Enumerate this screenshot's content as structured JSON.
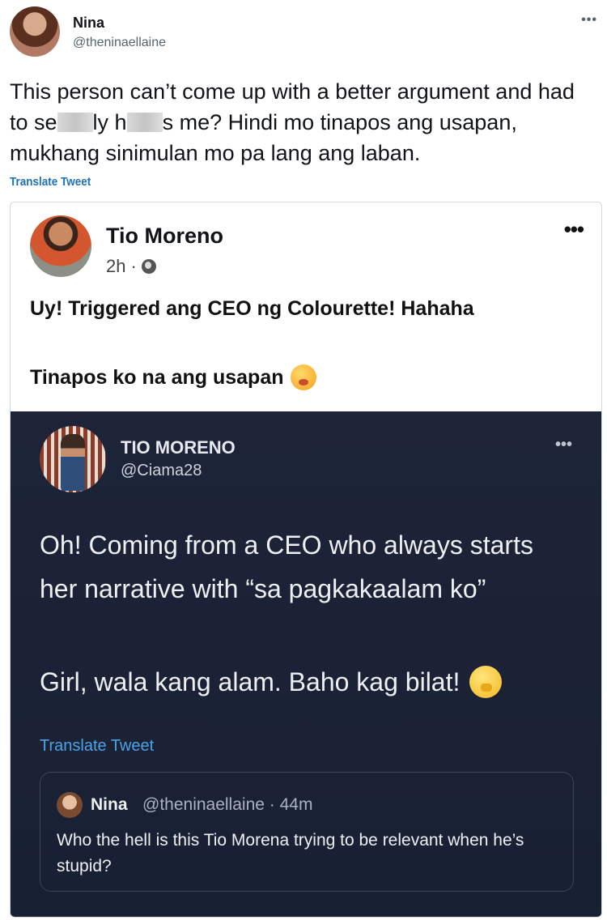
{
  "tweet": {
    "author_name": "Nina",
    "author_handle": "@theninaellaine",
    "more_icon": "more-horizontal-icon",
    "text_part1": "This person can’t come up with a better argument and had to se",
    "text_part2": "ly h",
    "text_part3": "s me? Hindi mo tinapos ang usapan, mukhang sinimulan mo pa lang ang laban.",
    "translate_label": "Translate Tweet"
  },
  "fb_post": {
    "author_name": "Tio Moreno",
    "time": "2h",
    "separator": "·",
    "privacy_icon": "globe-icon",
    "more_label": "•••",
    "line1": "Uy! Triggered ang CEO ng Colourette! Hahaha",
    "line2": "Tinapos ko na ang usapan",
    "emoji": "face-with-hand-over-mouth-emoji"
  },
  "embedded_tweet": {
    "author_name": "TIO MORENO",
    "author_handle": "@Ciama28",
    "more_label": "•••",
    "text1": "Oh! Coming from a CEO who always starts  her narrative with “sa pagkakaalam ko”",
    "text2": "Girl, wala kang alam. Baho kag bilat!",
    "emoji": "shushing-face-emoji",
    "translate_label": "Translate Tweet",
    "quote": {
      "author_name": "Nina",
      "author_handle_time": "@theninaellaine · 44m",
      "text": "Who the hell is this Tio Morena trying to be relevant when he’s stupid?"
    }
  },
  "colors": {
    "link_blue": "#1d72b8",
    "dark_panel_bg": "#1d2438",
    "dark_link": "#4aa3e8"
  }
}
